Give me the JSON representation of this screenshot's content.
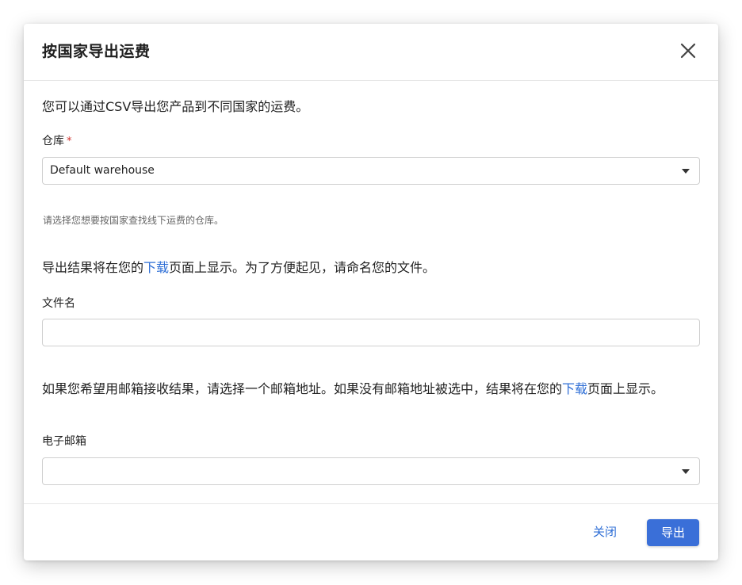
{
  "dialog": {
    "title": "按国家导出运费",
    "close_icon": "close-icon"
  },
  "intro_text": "您可以通过CSV导出您产品到不同国家的运费。",
  "warehouse": {
    "label": "仓库",
    "required_mark": "*",
    "value": "Default warehouse",
    "helper": "请选择您想要按国家查找线下运费的仓库。"
  },
  "download_note": {
    "before": "导出结果将在您的",
    "link": "下载",
    "after": "页面上显示。为了方便起见，请命名您的文件。"
  },
  "filename": {
    "label": "文件名",
    "value": ""
  },
  "email_note": {
    "before": "如果您希望用邮箱接收结果，请选择一个邮箱地址。如果没有邮箱地址被选中，结果将在您的",
    "link": "下载",
    "after": "页面上显示。"
  },
  "email": {
    "label": "电子邮箱",
    "value": ""
  },
  "footer": {
    "close_label": "关闭",
    "export_label": "导出"
  },
  "colors": {
    "accent": "#3a6fd8",
    "link": "#2f6fd6",
    "required": "#d0312d"
  }
}
